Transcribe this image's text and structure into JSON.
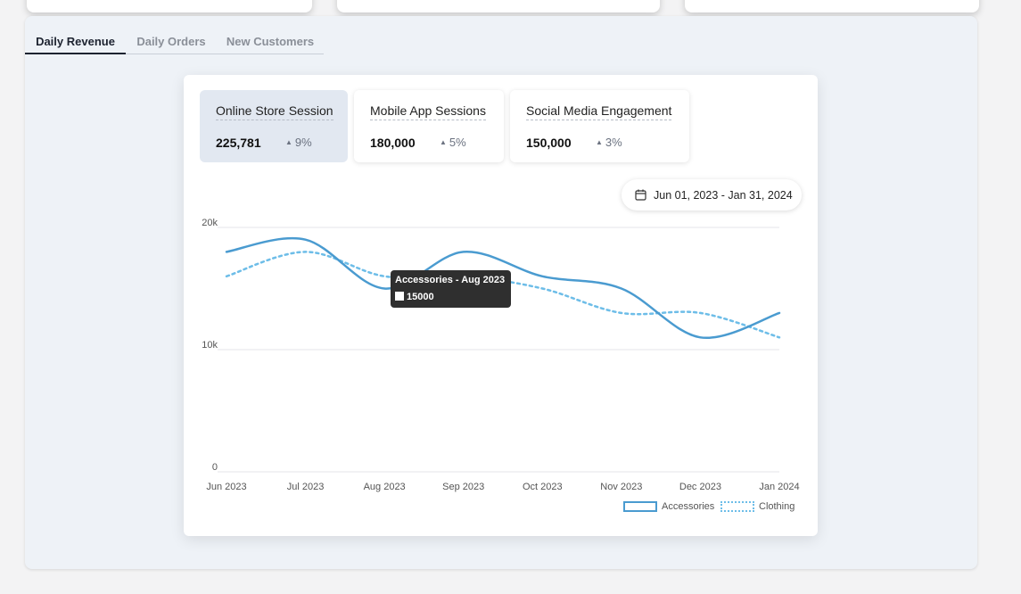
{
  "tabs": [
    {
      "label": "Daily Revenue",
      "active": true
    },
    {
      "label": "Daily Orders",
      "active": false
    },
    {
      "label": "New Customers",
      "active": false
    }
  ],
  "metrics": [
    {
      "title": "Online Store Session",
      "value": "225,781",
      "change": "9%",
      "active": true
    },
    {
      "title": "Mobile App Sessions",
      "value": "180,000",
      "change": "5%",
      "active": false
    },
    {
      "title": "Social Media Engagement",
      "value": "150,000",
      "change": "3%",
      "active": false
    }
  ],
  "date_range": {
    "label": "Jun 01, 2023 - Jan 31, 2024",
    "icon": "calendar-icon"
  },
  "tooltip": {
    "title": "Accessories -  Aug 2023",
    "value": "15000"
  },
  "colors": {
    "accessories": "#4a9bd0",
    "clothing": "#6dbde8",
    "accent": "#1d2330"
  },
  "chart_data": {
    "type": "line",
    "categories": [
      "Jun 2023",
      "Jul 2023",
      "Aug 2023",
      "Sep 2023",
      "Oct 2023",
      "Nov 2023",
      "Dec 2023",
      "Jan 2024"
    ],
    "y_ticks": [
      "0",
      "10k",
      "20k"
    ],
    "ylim": [
      0,
      20000
    ],
    "grid": true,
    "legend_position": "bottom-right",
    "series": [
      {
        "name": "Accessories",
        "style": "solid",
        "values": [
          18000,
          19000,
          15000,
          18000,
          16000,
          15000,
          11000,
          13000
        ]
      },
      {
        "name": "Clothing",
        "style": "dotted",
        "values": [
          16000,
          18000,
          16000,
          16000,
          15000,
          13000,
          13000,
          11000
        ]
      }
    ]
  }
}
